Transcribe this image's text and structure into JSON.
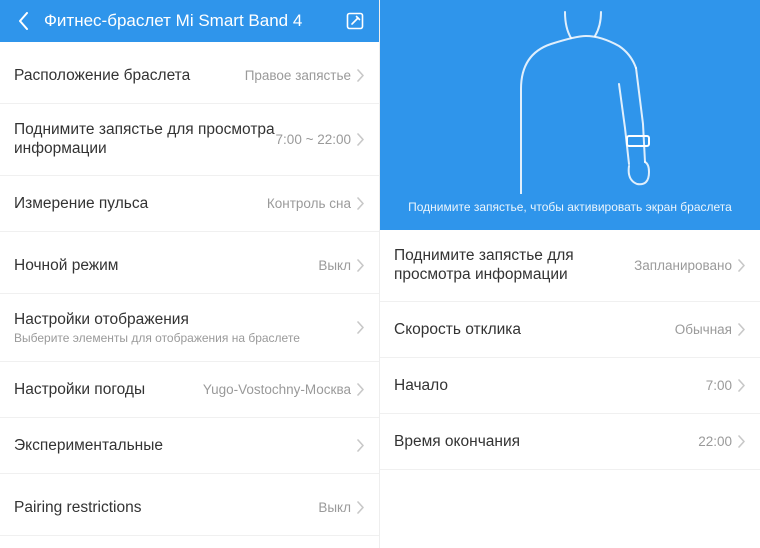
{
  "left": {
    "header": {
      "title": "Фитнес-браслет Mi Smart Band 4"
    },
    "rows": [
      {
        "title": "Расположение браслета",
        "value": "Правое запястье"
      },
      {
        "title": "Поднимите запястье для просмотра информации",
        "value": "7:00 ~ 22:00"
      },
      {
        "title": "Измерение пульса",
        "value": "Контроль сна"
      },
      {
        "title": "Ночной режим",
        "value": "Выкл"
      },
      {
        "title": "Настройки отображения",
        "subtitle": "Выберите элементы для отображения на браслете",
        "value": ""
      },
      {
        "title": "Настройки погоды",
        "value": "Yugo-Vostochny-Москва"
      },
      {
        "title": "Экспериментальные",
        "value": ""
      },
      {
        "title": "Pairing restrictions",
        "value": "Выкл"
      }
    ]
  },
  "right": {
    "hero_caption": "Поднимите запястье, чтобы активировать экран браслета",
    "rows": [
      {
        "title": "Поднимите запястье для просмотра информации",
        "value": "Запланировано"
      },
      {
        "title": "Скорость отклика",
        "value": "Обычная"
      },
      {
        "title": "Начало",
        "value": "7:00"
      },
      {
        "title": "Время окончания",
        "value": "22:00"
      }
    ]
  }
}
